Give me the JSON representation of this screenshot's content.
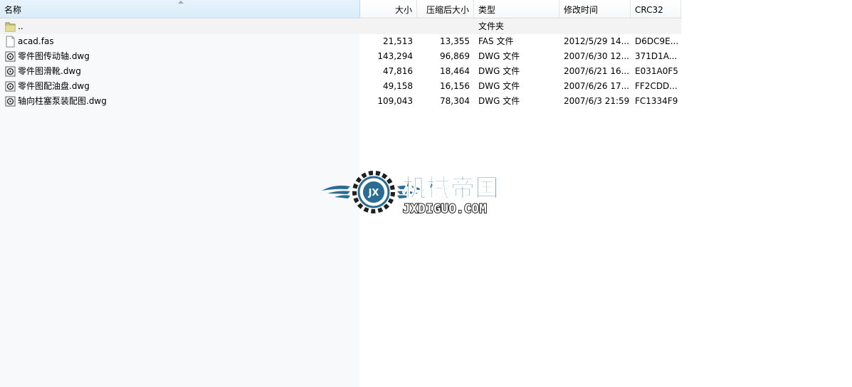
{
  "columns": {
    "name": "名称",
    "size": "大小",
    "packed": "压缩后大小",
    "type": "类型",
    "modified": "修改时间",
    "crc": "CRC32"
  },
  "files": [
    {
      "icon": "folder-icon",
      "name": "..",
      "size": "",
      "packed": "",
      "type": "文件夹",
      "modified": "",
      "crc": ""
    },
    {
      "icon": "document-icon",
      "name": "acad.fas",
      "size": "21,513",
      "packed": "13,355",
      "type": "FAS 文件",
      "modified": "2012/5/29 14...",
      "crc": "D6DC9E..."
    },
    {
      "icon": "dwg-icon",
      "name": "零件图传动轴.dwg",
      "size": "143,294",
      "packed": "96,869",
      "type": "DWG 文件",
      "modified": "2007/6/30 12...",
      "crc": "371D1A..."
    },
    {
      "icon": "dwg-icon",
      "name": "零件图滑靴.dwg",
      "size": "47,816",
      "packed": "18,464",
      "type": "DWG 文件",
      "modified": "2007/6/21 16...",
      "crc": "E031A0F5"
    },
    {
      "icon": "dwg-icon",
      "name": "零件图配油盘.dwg",
      "size": "49,158",
      "packed": "16,156",
      "type": "DWG 文件",
      "modified": "2007/6/26 17...",
      "crc": "FF2CDD..."
    },
    {
      "icon": "dwg-icon",
      "name": "轴向柱塞泵装配图.dwg",
      "size": "109,043",
      "packed": "78,304",
      "type": "DWG 文件",
      "modified": "2007/6/3 21:59",
      "crc": "FC1334F9"
    }
  ],
  "watermark": {
    "title": "机械帝国",
    "site": "JXDIGUO.COM",
    "emblem": "JX"
  },
  "colors": {
    "watermark_blue": "#2a6c93",
    "sorted_header": "#d9ecfa"
  }
}
